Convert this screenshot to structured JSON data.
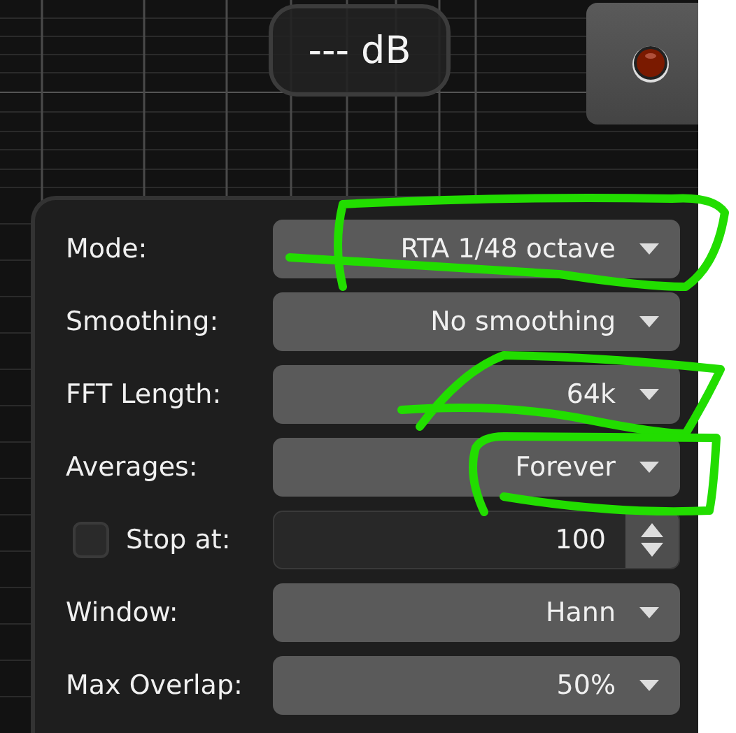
{
  "readout": "--- dB",
  "settings": [
    {
      "kind": "dropdown",
      "label": "Mode:",
      "value": "RTA 1/48 octave"
    },
    {
      "kind": "dropdown",
      "label": "Smoothing:",
      "value": "No smoothing"
    },
    {
      "kind": "dropdown",
      "label": "FFT Length:",
      "value": "64k"
    },
    {
      "kind": "dropdown",
      "label": "Averages:",
      "value": "Forever"
    },
    {
      "kind": "spinbox",
      "label": "Stop at:",
      "checked": false,
      "value": "100"
    },
    {
      "kind": "dropdown",
      "label": "Window:",
      "value": "Hann"
    },
    {
      "kind": "dropdown",
      "label": "Max Overlap:",
      "value": "50%"
    }
  ]
}
